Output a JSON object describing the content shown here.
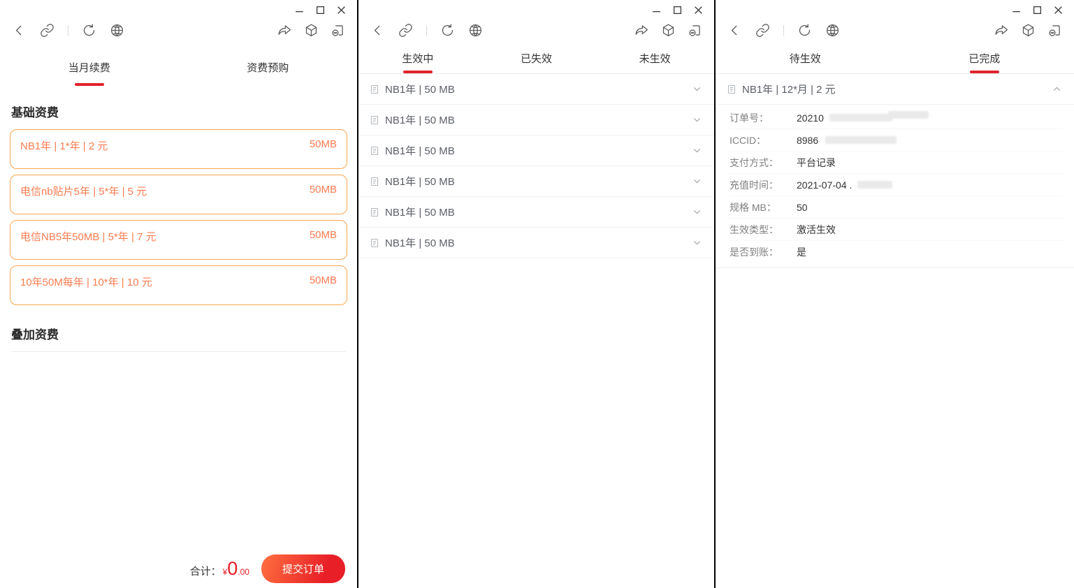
{
  "colors": {
    "accent_red": "#e1232b",
    "card_border": "#f9a64d",
    "card_text": "#fa7c50",
    "amount_red": "#e51c23",
    "btn_grad_start": "#ff7140",
    "btn_grad_end": "#e81f27"
  },
  "icons": {
    "back": "chevron-left",
    "link": "chain-link",
    "refresh": "circular-arrow",
    "globe": "wireframe-globe",
    "share": "forward-arrow",
    "cube": "3d-box",
    "floating_window": "circle-dots-bracket",
    "minimize": "–",
    "maximize": "□",
    "close": "×",
    "order_doc": "document-lines",
    "chevron_down": "⌄",
    "chevron_up": "⌃"
  },
  "windows": [
    {
      "tabs": [
        {
          "label": "当月续费"
        },
        {
          "label": "资费预购"
        }
      ],
      "sections": {
        "base": "基础资费",
        "stack": "叠加资费"
      },
      "plans": [
        {
          "name": "NB1年 | 1*年 | 2 元",
          "size": "50MB"
        },
        {
          "name": "电信nb贴片5年 | 5*年 | 5 元",
          "size": "50MB"
        },
        {
          "name": "电信NB5年50MB | 5*年 | 7 元",
          "size": "50MB"
        },
        {
          "name": "10年50M每年 | 10*年 | 10 元",
          "size": "50MB"
        }
      ],
      "footer": {
        "total_label": "合计：",
        "currency": "¥",
        "amount_int": "0",
        "amount_dec": ".00",
        "submit_label": "提交订单"
      }
    },
    {
      "tabs": [
        {
          "label": "生效中"
        },
        {
          "label": "已失效"
        },
        {
          "label": "未生效"
        }
      ],
      "items": [
        {
          "label": "NB1年 | 50 MB"
        },
        {
          "label": "NB1年 | 50 MB"
        },
        {
          "label": "NB1年 | 50 MB"
        },
        {
          "label": "NB1年 | 50 MB"
        },
        {
          "label": "NB1年 | 50 MB"
        },
        {
          "label": "NB1年 | 50 MB"
        }
      ]
    },
    {
      "tabs": [
        {
          "label": "待生效"
        },
        {
          "label": "已完成"
        }
      ],
      "item": {
        "label": "NB1年 | 12*月 | 2 元"
      },
      "details": [
        {
          "label": "订单号：",
          "value": "20210"
        },
        {
          "label": "ICCID：",
          "value": "8986"
        },
        {
          "label": "支付方式：",
          "value": "平台记录"
        },
        {
          "label": "充值时间：",
          "value": "2021-07-04 ."
        },
        {
          "label": "规格 MB：",
          "value": "50"
        },
        {
          "label": "生效类型：",
          "value": "激活生效"
        },
        {
          "label": "是否到账：",
          "value": "是"
        }
      ]
    }
  ]
}
